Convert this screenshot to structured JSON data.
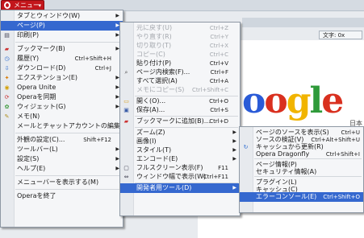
{
  "app": {
    "menu_button": "メニュー",
    "encoding": "文字: 0x"
  },
  "page": {
    "logo": [
      "o",
      "o",
      "g",
      "l",
      "e"
    ],
    "logo_sub": "日本"
  },
  "menu1": [
    {
      "label": "タブとウィンドウ(W)",
      "submenu": true,
      "icon": ""
    },
    {
      "label": "ページ(P)",
      "submenu": true,
      "icon": "",
      "highlight": true
    },
    {
      "label": "印刷(P)",
      "submenu": true,
      "icon": "printer-icon"
    },
    {
      "sep": true
    },
    {
      "label": "ブックマーク(B)",
      "submenu": true,
      "icon": "bookmark-icon"
    },
    {
      "label": "履歴(Y)",
      "shortcut": "Ctrl+Shift+H",
      "icon": "history-icon"
    },
    {
      "label": "ダウンロード(D)",
      "shortcut": "Ctrl+J",
      "icon": "download-icon"
    },
    {
      "label": "エクステンション(E)",
      "submenu": true,
      "icon": "extension-icon"
    },
    {
      "label": "Opera Unite",
      "submenu": true,
      "icon": "unite-icon"
    },
    {
      "label": "Operaを同期",
      "submenu": true,
      "icon": "sync-icon"
    },
    {
      "label": "ウィジェット(G)",
      "submenu": true,
      "icon": "widget-icon"
    },
    {
      "label": "メモ(N)",
      "icon": "notes-icon"
    },
    {
      "label": "メールとチャットアカウントの編集(M)...",
      "icon": ""
    },
    {
      "sep": true
    },
    {
      "label": "外観の設定(C)...",
      "shortcut": "Shift+F12",
      "icon": ""
    },
    {
      "label": "ツールバー(L)",
      "submenu": true,
      "icon": ""
    },
    {
      "label": "設定(S)",
      "submenu": true,
      "icon": ""
    },
    {
      "label": "ヘルプ(E)",
      "submenu": true,
      "icon": ""
    },
    {
      "sep": true
    },
    {
      "label": "メニューバーを表示する(M)",
      "icon": ""
    },
    {
      "sep": true
    },
    {
      "label": "Operaを終了",
      "icon": ""
    }
  ],
  "menu2": [
    {
      "label": "元に戻す(U)",
      "shortcut": "Ctrl+Z",
      "disabled": true
    },
    {
      "label": "やり直す(R)",
      "shortcut": "Ctrl+Y",
      "disabled": true
    },
    {
      "label": "切り取り(T)",
      "shortcut": "Ctrl+X",
      "disabled": true
    },
    {
      "label": "コピー(C)",
      "shortcut": "Ctrl+C",
      "disabled": true
    },
    {
      "label": "貼り付け(P)",
      "shortcut": "Ctrl+V"
    },
    {
      "label": "ページ内検索(F)...",
      "shortcut": "Ctrl+F",
      "icon": "find-icon"
    },
    {
      "label": "すべて選択(A)",
      "shortcut": "Ctrl+A"
    },
    {
      "label": "メモにコピー(S)",
      "shortcut": "Ctrl+Shift+C",
      "disabled": true
    },
    {
      "sep": true
    },
    {
      "label": "開く(O)...",
      "shortcut": "Ctrl+O",
      "icon": "folder-icon"
    },
    {
      "label": "保存(A)...",
      "shortcut": "Ctrl+S",
      "icon": "save-icon"
    },
    {
      "sep": true
    },
    {
      "label": "ブックマークに追加(B)...",
      "shortcut": "Ctrl+D",
      "icon": "bookmark-add-icon"
    },
    {
      "sep": true
    },
    {
      "label": "ズーム(Z)",
      "submenu": true
    },
    {
      "label": "画像(I)",
      "submenu": true
    },
    {
      "label": "スタイル(T)",
      "submenu": true
    },
    {
      "label": "エンコード(E)",
      "submenu": true
    },
    {
      "label": "フルスクリーン表示(F)",
      "shortcut": "F11",
      "icon": "fullscreen-icon"
    },
    {
      "label": "ウィンドウ幅で表示(W)",
      "shortcut": "Ctrl+F11",
      "icon": "fit-width-icon"
    },
    {
      "sep": true
    },
    {
      "label": "開発者用ツール(D)",
      "submenu": true,
      "highlight": true
    }
  ],
  "menu3": [
    {
      "label": "ページのソースを表示(S)",
      "shortcut": "Ctrl+U"
    },
    {
      "label": "ソースの検証(V)",
      "shortcut": "Ctrl+Alt+Shift+U"
    },
    {
      "label": "キャッシュから更新(R)",
      "icon": "refresh-icon"
    },
    {
      "label": "Opera Dragonfly",
      "shortcut": "Ctrl+Shift+I"
    },
    {
      "sep": true
    },
    {
      "label": "ページ情報(P)"
    },
    {
      "label": "セキュリティ情報(A)"
    },
    {
      "sep": true
    },
    {
      "label": "プラグイン(L)"
    },
    {
      "label": "キャッシュ(C)"
    },
    {
      "label": "エラーコンソール(E)",
      "shortcut": "Ctrl+Shift+O",
      "highlight": true
    }
  ]
}
